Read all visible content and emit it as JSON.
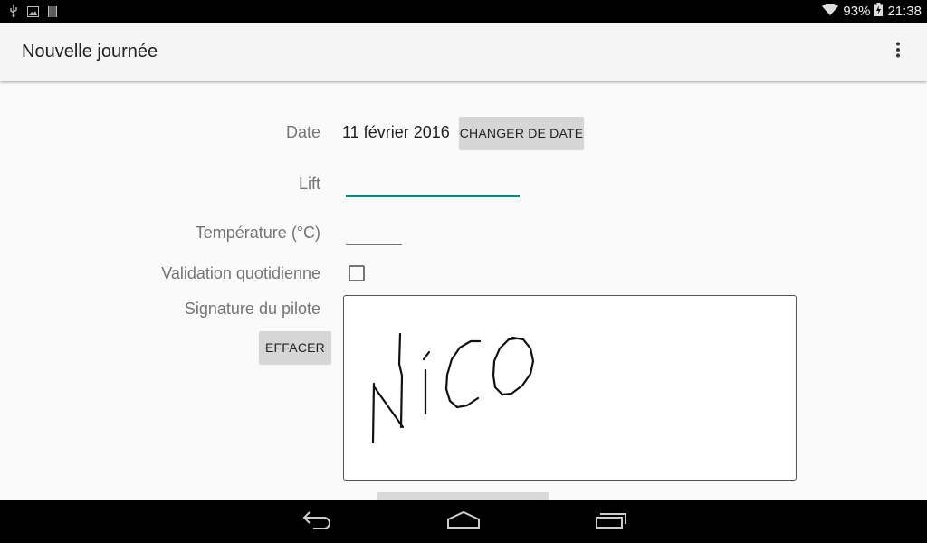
{
  "status_bar": {
    "battery": "93%",
    "time": "21:38",
    "left_icons": [
      "usb-icon",
      "image-icon",
      "barcode-icon"
    ],
    "right_icons": [
      "wifi-icon",
      "battery-charging-icon"
    ]
  },
  "app_bar": {
    "title": "Nouvelle journée",
    "overflow_icon": "more-vert-icon"
  },
  "form": {
    "date_label": "Date",
    "date_value": "11 février 2016",
    "change_date_button": "CHANGER DE DATE",
    "lift_label": "Lift",
    "lift_value": "",
    "temperature_label": "Température (°C)",
    "temperature_value": "",
    "validation_label": "Validation quotidienne",
    "validation_checked": false,
    "signature_label": "Signature du pilote",
    "clear_button": "EFFACER"
  },
  "nav_bar": {
    "icons": [
      "back-icon",
      "home-icon",
      "recents-icon"
    ]
  },
  "colors": {
    "accent": "#00897b",
    "app_bar_bg": "#f5f5f5",
    "button_bg": "#d6d6d6"
  }
}
